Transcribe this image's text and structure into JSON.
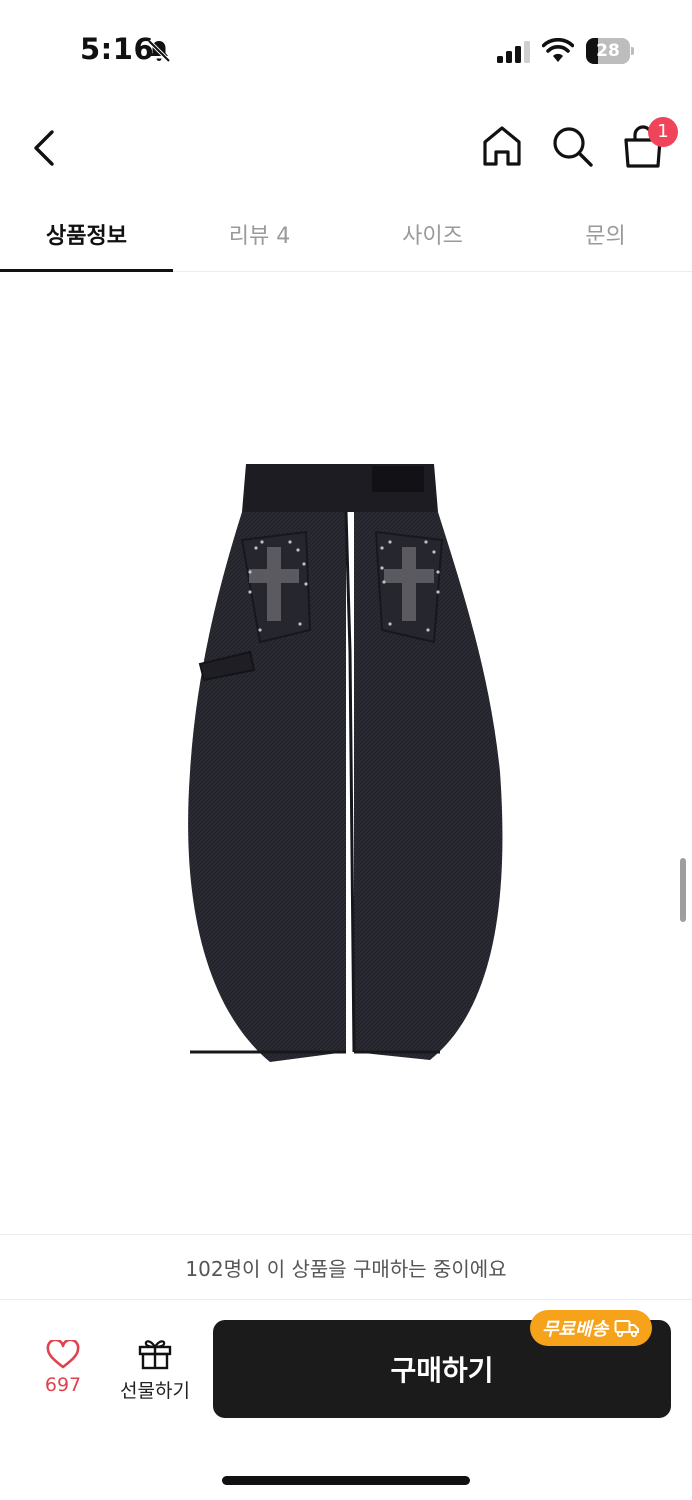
{
  "status_bar": {
    "time": "5:16",
    "battery": "28",
    "battery_level": 0.28
  },
  "header": {
    "back_icon": "chevron-left-icon",
    "home_icon": "home-icon",
    "search_icon": "search-icon",
    "cart_icon": "shopping-bag-icon",
    "cart_badge": "1"
  },
  "tabs": [
    {
      "label": "상품정보",
      "active": true
    },
    {
      "label": "리뷰 4",
      "active": false
    },
    {
      "label": "사이즈",
      "active": false
    },
    {
      "label": "문의",
      "active": false
    }
  ],
  "product": {
    "image_icon": "pants-image"
  },
  "notice": {
    "text": "102명이 이 상품을 구매하는 중이에요"
  },
  "bottom_bar": {
    "like_count": "697",
    "gift_label": "선물하기",
    "buy_label": "구매하기",
    "free_shipping_label": "무료배송"
  },
  "colors": {
    "accent": "#f0445a",
    "like": "#e0434e",
    "badge": "#f7a21b",
    "buy_button": "#1b1b1b"
  }
}
